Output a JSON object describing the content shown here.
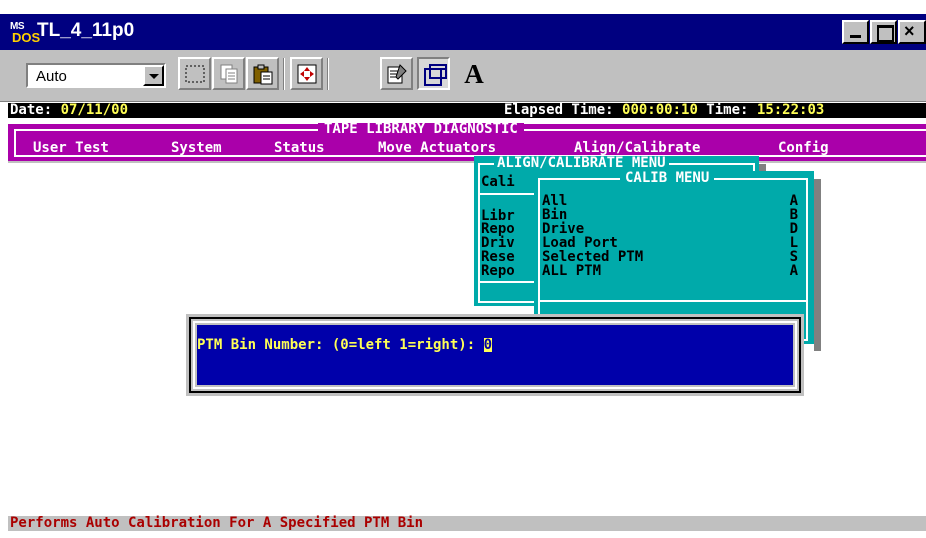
{
  "window": {
    "title": "TL_4_11p0",
    "icon_top": "MS",
    "icon_bottom": "DOS",
    "close_label": "×"
  },
  "toolbar": {
    "font_select_value": "Auto",
    "font_button_label": "A",
    "buttons": [
      "mark-icon",
      "copy-icon",
      "paste-icon",
      "full-screen-icon",
      "properties-icon",
      "background-icon",
      "font-icon"
    ]
  },
  "console": {
    "date_label": "Date: ",
    "date_value": "07/11/00",
    "elapsed_label": "Elapsed Time: ",
    "elapsed_value": "000:00:10",
    "time_label": " Time: ",
    "time_value": "15:22:03",
    "menu_title": "TAPE LIBRARY DIAGNOSTIC",
    "menu_items": [
      "User Test",
      "System",
      "Status",
      "Move Actuators",
      "Align/Calibrate",
      "Config"
    ],
    "align_menu": {
      "title": "ALIGN/CALIBRATE MENU",
      "items": [
        "Cali",
        "Libr",
        "Repo",
        "Driv",
        "Rese",
        "Repo"
      ]
    },
    "calib_menu": {
      "title": "CALIB MENU",
      "items": [
        {
          "label": "All",
          "hotkey": "A"
        },
        {
          "label": "Bin",
          "hotkey": "B"
        },
        {
          "label": "Drive",
          "hotkey": "D"
        },
        {
          "label": "Load Port",
          "hotkey": "L"
        },
        {
          "label": "Selected PTM",
          "hotkey": "S"
        },
        {
          "label": "ALL PTM",
          "hotkey": "A"
        }
      ]
    },
    "prompt": {
      "label": "PTM Bin Number: (0=left 1=right): ",
      "value": "0"
    },
    "help_text": "Performs Auto Calibration For A Specified PTM Bin"
  },
  "colors": {
    "title_bar": "#000080",
    "menu_bar": "#aa00aa",
    "popup_menu": "#00aaaa",
    "prompt_bg": "#0000aa",
    "prompt_text": "#ffff55",
    "help_text": "#aa0000"
  }
}
